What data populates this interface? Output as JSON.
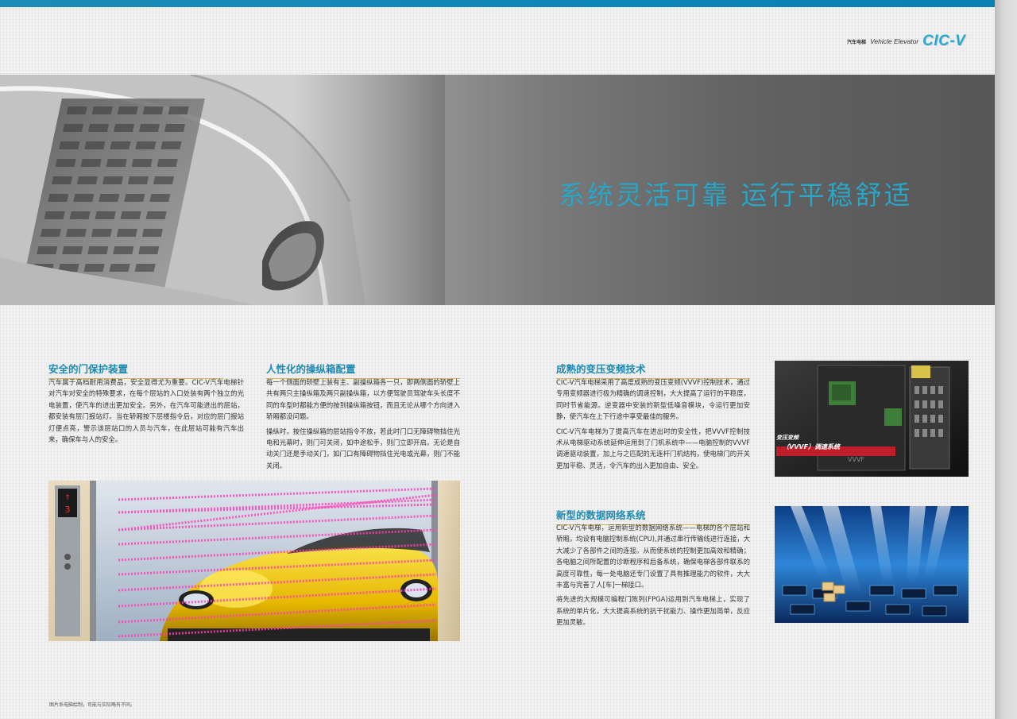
{
  "header": {
    "brand_cn": "汽车电梯",
    "brand_en": "Vehicle Elevator",
    "brand_logo": "CIC-V"
  },
  "banner": {
    "title": "系统灵活可靠  运行平稳舒适"
  },
  "sections": {
    "door": {
      "title": "安全的门保护装置",
      "paragraphs": [
        "汽车属于高档耐用消费品，安全显得尤为重要。CIC-V汽车电梯针对汽车对安全的特殊要求，在每个层站的入口处装有两个独立的光电装置，使汽车的进出更加安全。另外，在汽车可能进出的层站，都安装有层门报站灯。当在轿厢按下层楼指令后，对应的层门报站灯便点亮，警示该层站口的人员与汽车，在此层站可能有汽车出来，确保车与人的安全。"
      ]
    },
    "panel": {
      "title": "人性化的操纵箱配置",
      "paragraphs": [
        "每一个侧面的轿壁上装有主、副操纵箱各一只，即两侧面的轿壁上共有两只主操纵箱及两只副操纵箱，以方便驾驶员驾驶车头长度不同的车型时都能方便的按到操纵箱按钮，而且无论从哪个方向进入轿厢都没问题。",
        "操纵时，按住操纵箱的层站指令不放，若此时门口无障碍物挡住光电和光幕时，则门可关闭，如中途松手，则门立即开启。无论是自动关门还是手动关门，如门口有障碍物挡住光电或光幕，则门不能关闭。"
      ]
    },
    "vvvf": {
      "title": "成熟的变压变频技术",
      "paragraphs": [
        "CIC-V汽车电梯采用了高度成熟的变压变频(VVVF)控制技术，通过专用变频器进行极为精确的调速控制，大大提高了运行的平稳度，同时节省能源。逆变器中安装的新型低噪音模块，令运行更加安静，使汽车在上下行途中享受最佳的服务。",
        "CIC-V汽车电梯为了提高汽车在进出时的安全性，把VVVF控制技术从电梯驱动系统延伸运用到了门机系统中——电脑控制的VVVF调速驱动装置，加上与之匹配的无连杆门机结构，使电梯门的开关更加平稳、灵活，令汽车的出入更加自由、安全。"
      ]
    },
    "network": {
      "title": "新型的数据网络系统",
      "paragraphs": [
        "CIC-V汽车电梯，运用新型的数据网络系统——电梯的各个层站和轿厢，均设有电脑控制系统(CPU),并通过串行传输线进行连接，大大减少了各部件之间的连接。从而使系统的控制更加高效和精确；各电脑之间所配置的诊断程序和后备系统，确保电梯各部件联系的高度可靠性，每一处电脑还专门设置了具有推理能力的软件，大大丰富与完善了人[车]一梯接口。",
        "将先进的大规模可编程门陈列(FPGA)运用到汽车电梯上，实现了系统的单片化，大大提高系统的抗干扰能力、操作更加简单，反应更加灵敏。"
      ]
    }
  },
  "images": {
    "vvvf_caption_line1": "变压变频",
    "vvvf_caption_line2": "（VVVF）调速系统",
    "vvvf_board_text": "VVVF",
    "floor_indicator": "3"
  },
  "footer": {
    "note": "图片系电脑绘制，可能与实际略有不同。"
  },
  "colors": {
    "accent": "#1d8ab2",
    "title_teal": "#2aa6c6",
    "underline_gold": "#d9b45a"
  }
}
